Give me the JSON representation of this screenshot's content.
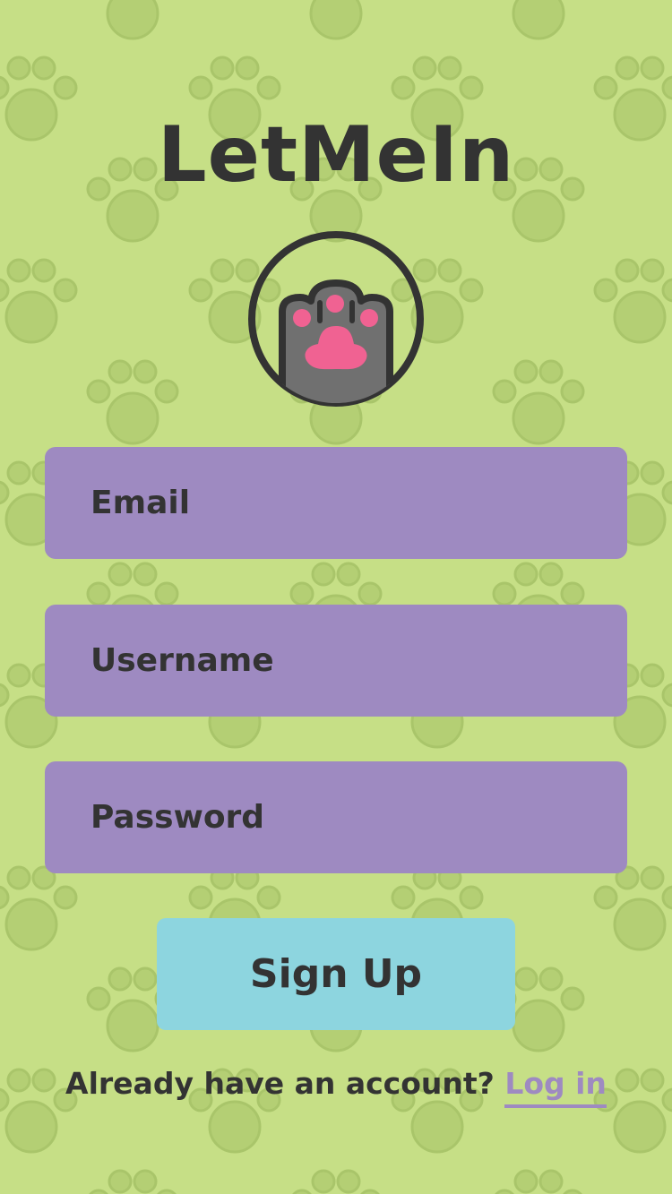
{
  "app": {
    "title": "LetMeIn",
    "logo_icon": "cat-paw-icon"
  },
  "form": {
    "email_placeholder": "Email",
    "username_placeholder": "Username",
    "password_placeholder": "Password",
    "signup_label": "Sign Up"
  },
  "footer": {
    "prompt": "Already have an account?",
    "login_label": "Log in"
  },
  "colors": {
    "background": "#c6df86",
    "paw_pattern": "#b4cf74",
    "input_fill": "#9e8ac1",
    "button_fill": "#8dd5df",
    "text": "#333333",
    "link": "#9e8ac1",
    "paw_pad": "#f06292",
    "paw_fur": "#707070"
  }
}
